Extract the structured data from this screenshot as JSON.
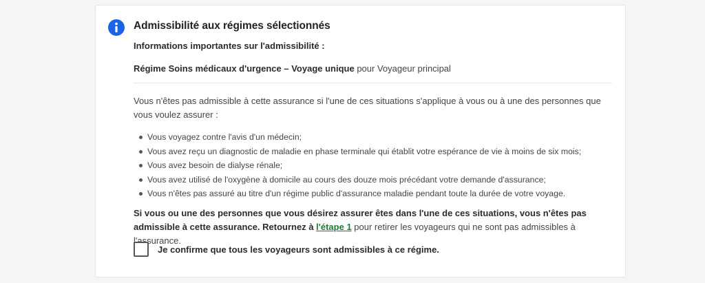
{
  "card": {
    "title": "Admissibilité aux régimes sélectionnés",
    "subtitle": "Informations importantes sur l'admissibilité :",
    "plan_name": "Régime Soins médicaux d'urgence – Voyage unique",
    "plan_for": " pour Voyageur principal",
    "intro": "Vous n'êtes pas admissible à cette assurance si l'une de ces situations s'applique à vous ou à une des personnes que vous voulez assurer :",
    "conditions": [
      "Vous voyagez contre l'avis d'un médecin;",
      "Vous avez reçu un diagnostic de maladie en phase terminale qui établit votre espérance de vie à moins de six mois;",
      "Vous avez besoin de dialyse rénale;",
      "Vous avez utilisé de l'oxygène à domicile au cours des douze mois précédant votre demande d'assurance;",
      "Vous n'êtes pas assuré au titre d'un régime public d'assurance maladie pendant toute la durée de votre voyage."
    ],
    "warning_text": "Si vous ou une des personnes que vous désirez assurer êtes dans l'une de ces situations, vous n'êtes pas admissible à cette assurance. Retournez à ",
    "step_link": "l'étape 1",
    "warning_after": " pour retirer les voyageurs qui ne sont pas admissibles à l'assurance.",
    "confirm_label": "Je confirme que tous les voyageurs sont admissibles à ce régime.",
    "confirm_checked": false
  },
  "icons": {
    "info": "info-icon"
  },
  "colors": {
    "accent": "#1b63e8",
    "link": "#1f7a3a"
  }
}
